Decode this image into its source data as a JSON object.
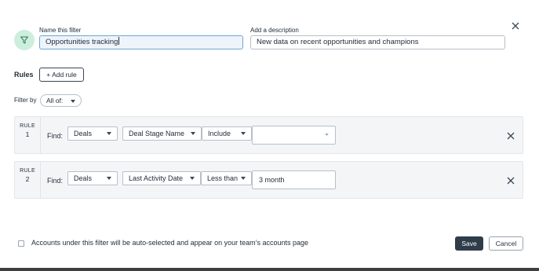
{
  "header": {
    "name_label": "Name this filter",
    "name_value": "Opportunities tracking",
    "description_label": "Add a description",
    "description_value": "New data on recent opportunities and champions",
    "icon": "filter-funnel-icon",
    "close_icon": "close-icon"
  },
  "rules_section": {
    "label": "Rules",
    "add_rule_label": "+ Add rule",
    "filter_by_label": "Filter by",
    "filter_by_value": "All of:"
  },
  "rules": [
    {
      "word": "RULE",
      "number": "1",
      "find_label": "Find:",
      "object": "Deals",
      "field": "Deal Stage Name",
      "operator": "Include",
      "value": ""
    },
    {
      "word": "RULE",
      "number": "2",
      "find_label": "Find:",
      "object": "Deals",
      "field": "Last Activity Date",
      "operator": "Less than",
      "value": "3 month"
    }
  ],
  "footer": {
    "checkbox_checked": false,
    "checkbox_text": "Accounts under this filter will be auto-selected and appear on your team’s accounts page",
    "save_label": "Save",
    "cancel_label": "Cancel"
  },
  "colors": {
    "icon_circle": "#cdeedd",
    "save_button": "#2f3d4a",
    "focused_border": "#6aa7d8"
  }
}
